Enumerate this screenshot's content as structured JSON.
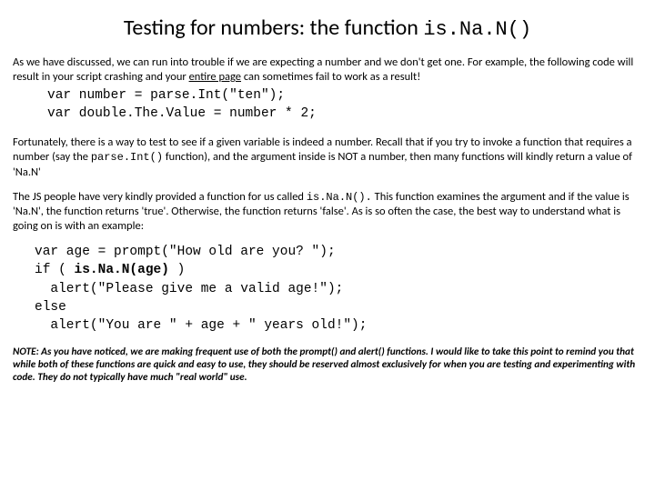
{
  "title": {
    "pre": "Testing for numbers: the function ",
    "mono": "is.Na.N()"
  },
  "p1": {
    "a": "As we have discussed, we can run into trouble if we are expecting a number and we don't get one. For example, the following code will result in your script crashing and your ",
    "u": "entire page",
    "b": " can sometimes fail to work as a result!"
  },
  "code1": {
    "l1": "var number = parse.Int(\"ten\");",
    "l2": "var double.The.Value = number * 2;"
  },
  "p2": {
    "a": "Fortunately, there is a way to test to see if a given variable is indeed a number. Recall that if you try to invoke a function that requires a number (say the ",
    "mono": "parse.Int()",
    "b": "  function), and the argument inside is NOT a number, then many functions will kindly return a value of 'Na.N'"
  },
  "p3": {
    "a": "The JS people have very kindly provided a function for us called ",
    "mono": "is.Na.N().",
    "b": " This function examines the argument and if the value is 'Na.N', the function returns 'true'. Otherwise, the function returns 'false'. As is so often the case, the best way to understand what is going on is with an example:"
  },
  "code2": {
    "l1": "var age = prompt(\"How old are you? \");",
    "l2a": "if ( ",
    "l2b": "is.Na.N(age)",
    "l2c": " )",
    "l3": "  alert(\"Please give me a valid age!\");",
    "l4": "else",
    "l5": "  alert(\"You are \" + age + \" years old!\");"
  },
  "note": "NOTE:  As you have noticed, we are making frequent use of both the prompt() and alert() functions. I would like to take this point to remind you that while both of these functions are quick and easy to use, they should be reserved almost exclusively for when you are testing and experimenting with code. They do not typically have much \"real world\" use."
}
